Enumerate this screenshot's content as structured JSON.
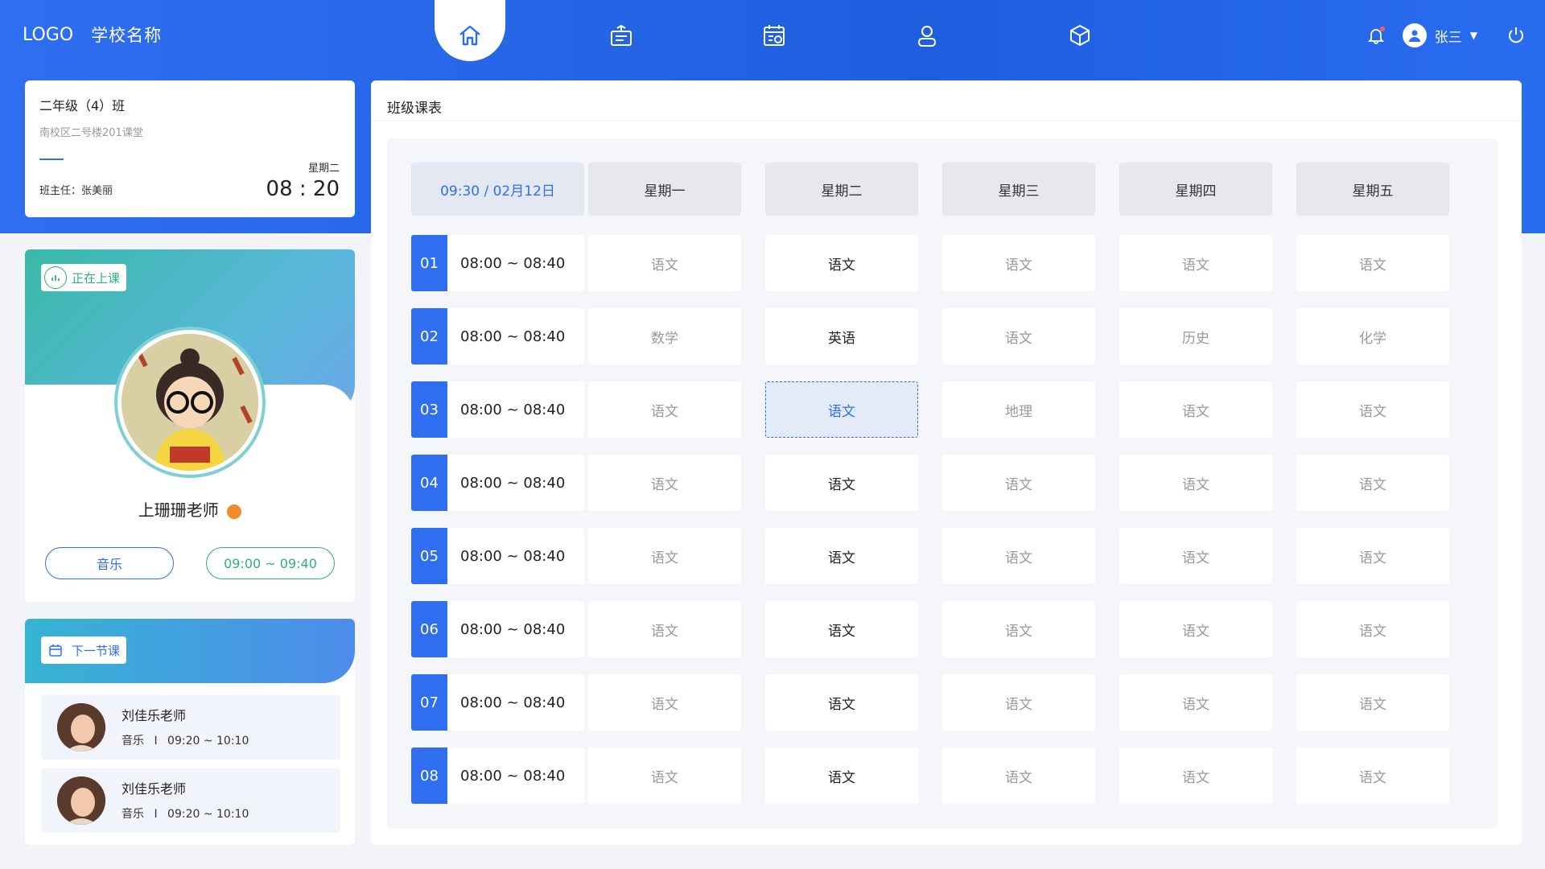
{
  "header": {
    "logo": "LOGO",
    "school": "学校名称",
    "nav_icons": [
      "home-icon",
      "classroom-icon",
      "schedule-icon",
      "person-icon",
      "box-icon"
    ],
    "user_name": "张三",
    "colors": {
      "primary": "#2f6ef0",
      "green": "#2fae7f"
    }
  },
  "class_card": {
    "name": "二年级（4）班",
    "room": "南校区二号楼201课堂",
    "teacher": "班主任：张美丽",
    "weekday": "星期二",
    "time": "08 : 20"
  },
  "current": {
    "tag": "正在上课",
    "teacher": "上珊珊老师",
    "subject": "音乐",
    "time": "09:00 ~ 09:40"
  },
  "next": {
    "tag": "下一节课",
    "items": [
      {
        "name": "刘佳乐老师",
        "subject": "音乐",
        "sep": "I",
        "time": "09:20 ~ 10:10"
      },
      {
        "name": "刘佳乐老师",
        "subject": "音乐",
        "sep": "I",
        "time": "09:20 ~ 10:10"
      }
    ]
  },
  "schedule": {
    "title": "班级课表",
    "header_time": "09:30 / 02月12日",
    "days": [
      "星期一",
      "星期二",
      "星期三",
      "星期四",
      "星期五"
    ],
    "slots": [
      {
        "num": "01",
        "time": "08:00 ~ 08:40",
        "subjects": [
          "语文",
          "语文",
          "语文",
          "语文",
          "语文"
        ]
      },
      {
        "num": "02",
        "time": "08:00 ~ 08:40",
        "subjects": [
          "数学",
          "英语",
          "语文",
          "历史",
          "化学"
        ]
      },
      {
        "num": "03",
        "time": "08:00 ~ 08:40",
        "subjects": [
          "语文",
          "语文",
          "地理",
          "语文",
          "语文"
        ]
      },
      {
        "num": "04",
        "time": "08:00 ~ 08:40",
        "subjects": [
          "语文",
          "语文",
          "语文",
          "语文",
          "语文"
        ]
      },
      {
        "num": "05",
        "time": "08:00 ~ 08:40",
        "subjects": [
          "语文",
          "语文",
          "语文",
          "语文",
          "语文"
        ]
      },
      {
        "num": "06",
        "time": "08:00 ~ 08:40",
        "subjects": [
          "语文",
          "语文",
          "语文",
          "语文",
          "语文"
        ]
      },
      {
        "num": "07",
        "time": "08:00 ~ 08:40",
        "subjects": [
          "语文",
          "语文",
          "语文",
          "语文",
          "语文"
        ]
      },
      {
        "num": "08",
        "time": "08:00 ~ 08:40",
        "subjects": [
          "语文",
          "语文",
          "语文",
          "语文",
          "语文"
        ]
      }
    ]
  }
}
